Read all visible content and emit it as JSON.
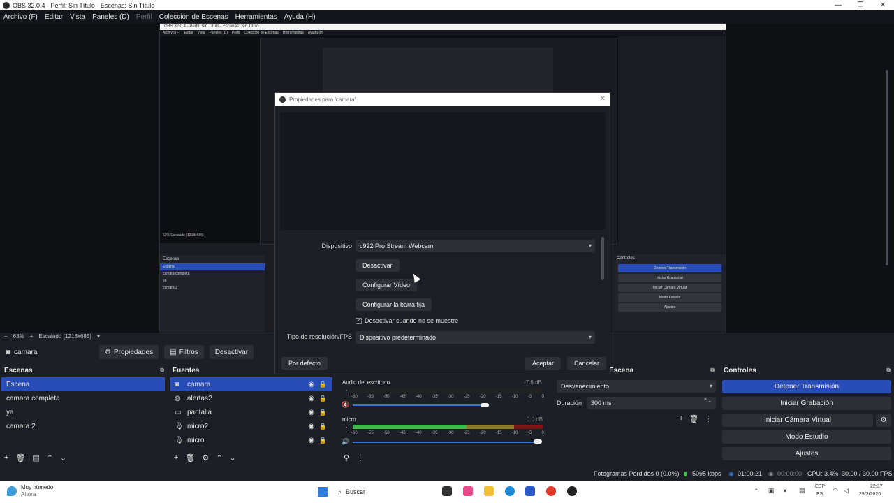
{
  "window": {
    "title": "OBS 32.0.4 - Perfil: Sin Título - Escenas: Sin Título",
    "controls": [
      "—",
      "❐",
      "✕"
    ]
  },
  "menu": [
    "Archivo (F)",
    "Editar",
    "Vista",
    "Paneles (D)",
    "Perfil",
    "Colección de Escenas",
    "Herramientas",
    "Ayuda (H)"
  ],
  "nested": {
    "title": "OBS 32.0.4 - Perfil: Sin Título - Escenas: Sin Título",
    "menu": [
      "Archivo (F)",
      "Editar",
      "Vista",
      "Paneles (D)",
      "Perfil",
      "Colección de Escenas",
      "Herramientas",
      "Ayuda (H)"
    ],
    "zoom": "63%   Escalado (1218x685)",
    "scenes_title": "Escenas",
    "scenes": [
      "Escena",
      "camara completa",
      "ya",
      "camara 2"
    ],
    "controls_title": "Controles",
    "controls": [
      "Detener Transmisión",
      "Iniciar Grabación",
      "Iniciar Cámara Virtual",
      "Modo Estudio",
      "Ajustes"
    ]
  },
  "zoom_strip": {
    "minus": "−",
    "zoom": "63%",
    "plus": "+",
    "scale": "Escalado (1218x685)"
  },
  "source_toolbar": {
    "source": "camara",
    "properties": "Propiedades",
    "filters": "Filtros",
    "deactivate": "Desactivar"
  },
  "scenes": {
    "title": "Escenas",
    "items": [
      "Escena",
      "camara completa",
      "ya",
      "camara 2"
    ]
  },
  "sources": {
    "title": "Fuentes",
    "items": [
      {
        "name": "camara",
        "icon": "camera-icon"
      },
      {
        "name": "alertas2",
        "icon": "browser-icon"
      },
      {
        "name": "pantalla",
        "icon": "monitor-icon"
      },
      {
        "name": "micro2",
        "icon": "mic-icon"
      },
      {
        "name": "micro",
        "icon": "mic-icon"
      }
    ]
  },
  "mixer": {
    "channels": [
      {
        "name": "Audio del escritorio",
        "db": "-7.8 dB",
        "level": 0.0
      },
      {
        "name": "micro",
        "db": "0.0 dB",
        "level": 0.85
      }
    ],
    "ticks": [
      "-60",
      "-55",
      "-50",
      "-45",
      "-40",
      "-35",
      "-30",
      "-25",
      "-20",
      "-15",
      "-10",
      "-5",
      "0"
    ]
  },
  "transitions": {
    "title": "Escena",
    "type": "Desvanecimiento",
    "duration_label": "Duración",
    "duration": "300 ms"
  },
  "controls": {
    "title": "Controles",
    "stream": "Detener Transmisión",
    "record": "Iniciar Grabación",
    "virtualcam": "Iniciar Cámara Virtual",
    "studio": "Modo Estudio",
    "settings": "Ajustes"
  },
  "status": {
    "dropped": "Fotogramas Perdidos 0 (0.0%)",
    "bitrate": "5095 kbps",
    "stream_time": "01:00:21",
    "rec_time": "00:00:00",
    "cpu": "CPU: 3.4%",
    "fps": "30.00 / 30.00 FPS"
  },
  "dialog": {
    "title": "Propiedades para 'camara'",
    "device_label": "Dispositivo",
    "device": "c922 Pro Stream Webcam",
    "btn_deactivate": "Desactivar",
    "btn_config_video": "Configurar Vídeo",
    "btn_config_bar": "Configurar la barra fija",
    "checkbox": "Desactivar cuando no se muestre",
    "res_label": "Tipo de resolución/FPS",
    "res": "Dispositivo predeterminado",
    "default": "Por defecto",
    "ok": "Aceptar",
    "cancel": "Cancelar"
  },
  "taskbar": {
    "weather_line1": "Muy húmedo",
    "weather_line2": "Ahora",
    "search": "Buscar",
    "lang1": "ESP",
    "lang2": "ES",
    "time": "22:37",
    "date": "29/3/2026"
  },
  "colors": {
    "accent": "#284cb8",
    "meter_green": "#3fb84a",
    "meter_yellow": "#c8b030",
    "meter_red": "#b82020"
  }
}
